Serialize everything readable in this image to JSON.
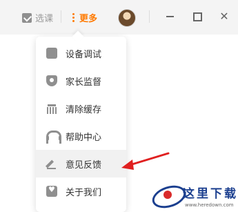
{
  "topbar": {
    "course_label": "选课",
    "more_label": "更多",
    "close_symbol": "✕"
  },
  "menu": {
    "items": [
      {
        "label": "设备调试",
        "icon": "device-test-icon"
      },
      {
        "label": "家长监督",
        "icon": "parent-supervision-icon"
      },
      {
        "label": "清除缓存",
        "icon": "clear-cache-icon"
      },
      {
        "label": "帮助中心",
        "icon": "headset-icon"
      },
      {
        "label": "意见反馈",
        "icon": "pencil-icon"
      },
      {
        "label": "关于我们",
        "icon": "about-icon"
      }
    ],
    "highlighted_index": 4
  },
  "watermark": {
    "text": "这里下载",
    "url": "www.heredown.com"
  },
  "colors": {
    "accent": "#ff7a00",
    "annotation_arrow": "#e02020",
    "watermark_blue": "#1b3f8f"
  }
}
